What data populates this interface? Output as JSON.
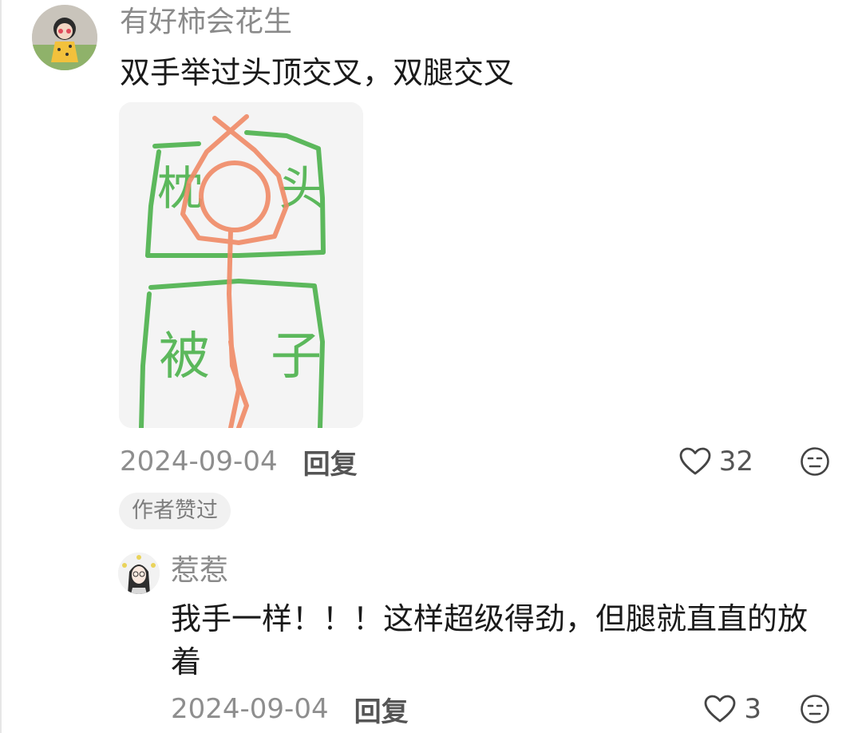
{
  "comment": {
    "username": "有好柿会花生",
    "content": "双手举过头顶交叉，双腿交叉",
    "image": {
      "labels": [
        "枕",
        "头",
        "被",
        "子"
      ],
      "colors": {
        "box": "#5cb85c",
        "figure": "#f08a66"
      }
    },
    "date": "2024-09-04",
    "reply_label": "回复",
    "like_count": "32",
    "author_badge": "作者赞过"
  },
  "reply": {
    "username": "惹惹",
    "content": "我手一样！！！这样超级得劲，但腿就直直的放着",
    "date": "2024-09-04",
    "reply_label": "回复",
    "like_count": "3"
  },
  "icons": {
    "like": "heart-outline-icon",
    "emoji": "neutral-face-icon"
  }
}
